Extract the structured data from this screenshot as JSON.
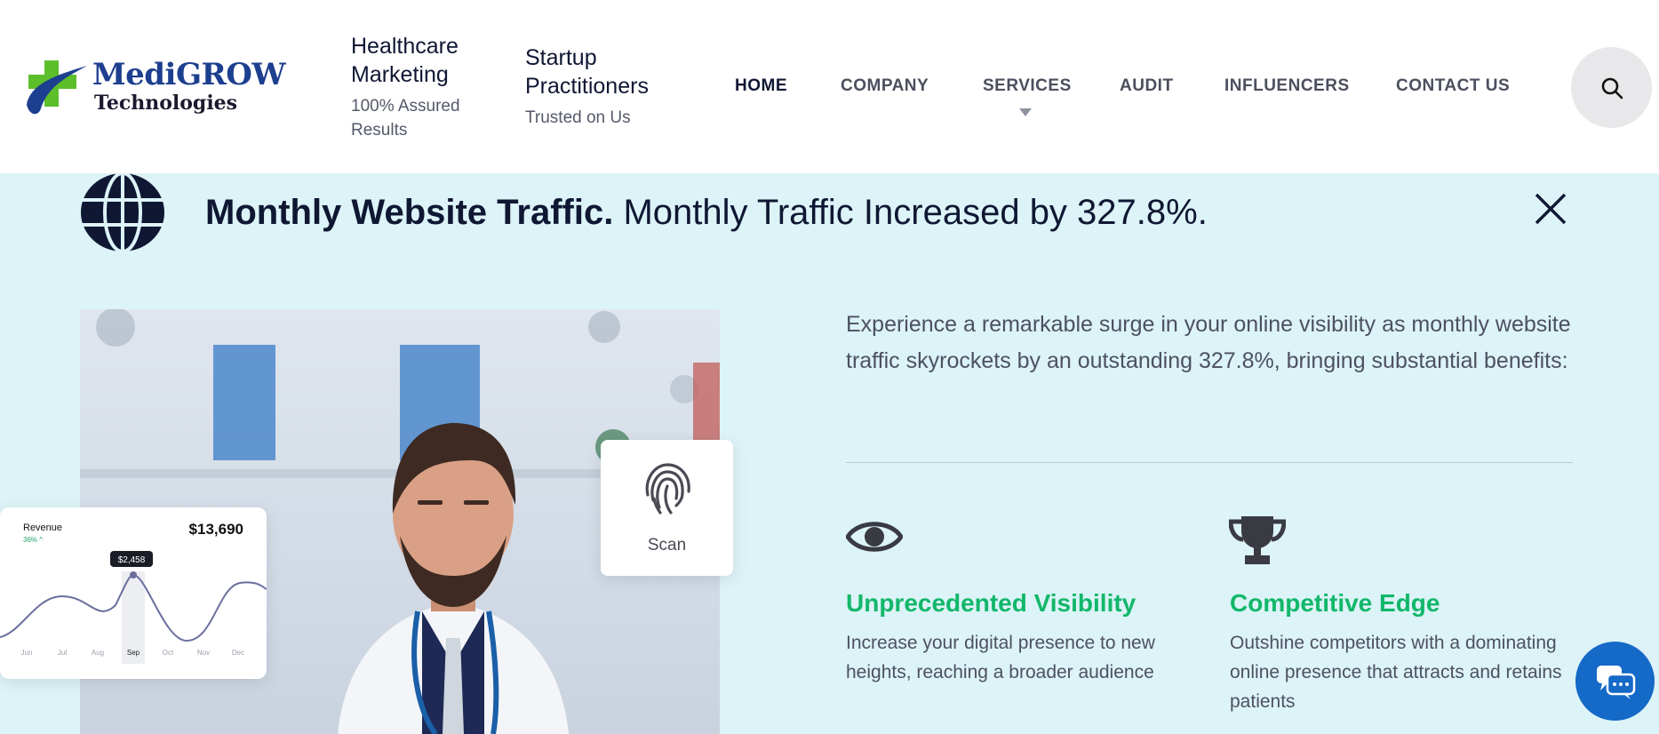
{
  "header": {
    "logo": {
      "name": "MediGROW",
      "sub": "Technologies"
    },
    "tagline1": {
      "title": "Healthcare Marketing",
      "sub": "100% Assured Results"
    },
    "tagline2": {
      "title": "Startup Practitioners",
      "sub": "Trusted on Us"
    },
    "nav": [
      {
        "label": "HOME",
        "active": true
      },
      {
        "label": "COMPANY",
        "active": false
      },
      {
        "label": "SERVICES",
        "active": false,
        "has_dropdown": true
      },
      {
        "label": "AUDIT",
        "active": false
      },
      {
        "label": "INFLUENCERS",
        "active": false
      },
      {
        "label": "CONTACT US",
        "active": false
      }
    ],
    "search_icon": "search-icon"
  },
  "banner": {
    "headline_bold": "Monthly Website Traffic.",
    "headline_rest": " Monthly Traffic Increased by 327.8%.",
    "globe_icon": "globe-icon",
    "close_icon": "close-icon"
  },
  "revenue_card": {
    "label": "Revenue",
    "change": "36% ^",
    "amount": "$13,690",
    "tooltip": "$2,458",
    "months": [
      "Jun",
      "Jul",
      "Aug",
      "Sep",
      "Oct",
      "Nov",
      "Dec"
    ],
    "highlight_month": "Sep"
  },
  "scan_card": {
    "label": "Scan",
    "icon": "fingerprint-icon"
  },
  "description": "Experience a remarkable surge in your online visibility as monthly website traffic skyrockets by an outstanding 327.8%, bringing substantial benefits:",
  "features": [
    {
      "icon": "eye-icon",
      "title": "Unprecedented Visibility",
      "text": "Increase your digital presence to new heights, reaching a broader audience"
    },
    {
      "icon": "trophy-icon",
      "title": "Competitive Edge",
      "text": "Outshine competitors with a dominating online presence that attracts and retains patients"
    }
  ],
  "colors": {
    "accent_green": "#12b76a",
    "band_bg": "#dcf3f7",
    "navy": "#0f1733",
    "chat_blue": "#1569c7"
  },
  "chat_icon": "chat-icon"
}
